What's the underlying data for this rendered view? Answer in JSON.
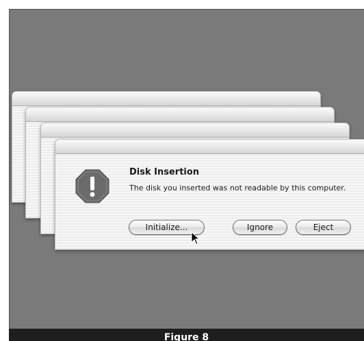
{
  "dialog": {
    "title": "Disk Insertion",
    "message": "The disk you inserted was not readable by this computer.",
    "icon": "caution-octagon-icon",
    "buttons": {
      "initialize": "Initialize...",
      "ignore": "Ignore",
      "eject": "Eject"
    }
  },
  "caption": "Figure 8",
  "colors": {
    "desktop": "#7a7a7a",
    "caption_bar": "#1e1e1e",
    "icon_fill": "#6b6b6b"
  }
}
